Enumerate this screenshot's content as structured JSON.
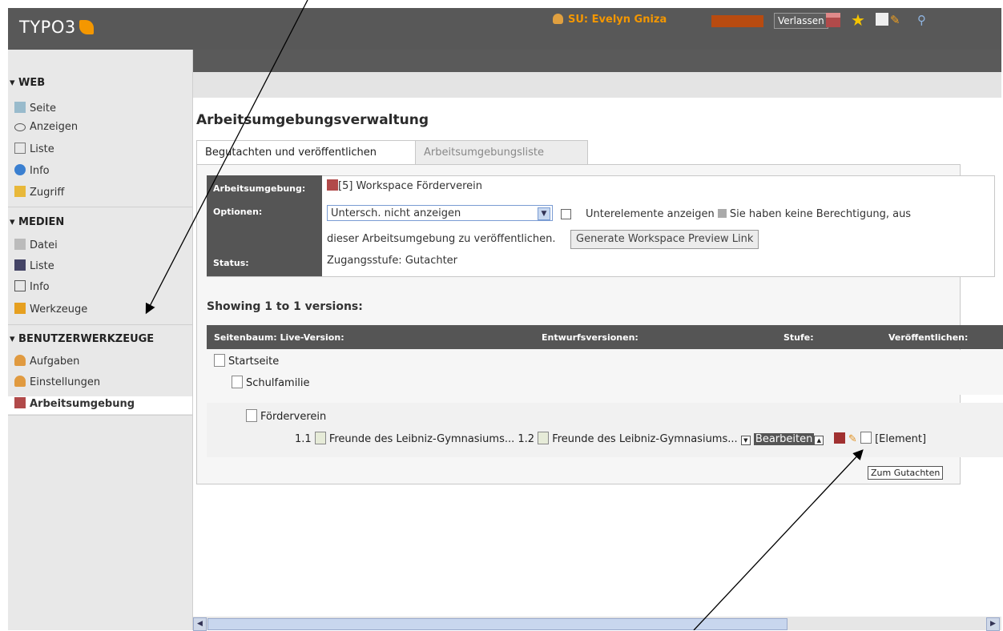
{
  "app": {
    "logo": "TYPO3"
  },
  "topbar": {
    "user_label": "SU: Evelyn Gniza",
    "leave_button": "Verlassen",
    "icons": [
      "workspace-icon",
      "star-icon",
      "clipboard-icon",
      "edit-icon",
      "search-icon"
    ]
  },
  "sidebar": {
    "sections": [
      {
        "title": "▾ WEB",
        "items": [
          "Seite",
          "Anzeigen",
          "Liste",
          "Info",
          "Zugriff"
        ]
      },
      {
        "title": "▾ MEDIEN",
        "items": [
          "Datei",
          "Liste",
          "Info",
          "Werkzeuge"
        ]
      },
      {
        "title": "▾ BENUTZERWERKZEUGE",
        "items": [
          "Aufgaben",
          "Einstellungen",
          "Arbeitsumgebung"
        ]
      }
    ],
    "active_item": "Arbeitsumgebung"
  },
  "main": {
    "title": "Arbeitsumgebungsverwaltung",
    "tabs": [
      {
        "label": "Begutachten und veröffentlichen",
        "active": true
      },
      {
        "label": "Arbeitsumgebungsliste",
        "active": false
      }
    ],
    "info": {
      "workspace_label": "Arbeitsumgebung:",
      "workspace_value": "[5] Workspace Förderverein",
      "options_label": "Optionen:",
      "select_value": "Untersch. nicht anzeigen",
      "checkbox_label": "Unterelemente anzeigen",
      "no_permission_1": "Sie haben keine Berechtigung, aus",
      "no_permission_2": "dieser Arbeitsumgebung zu veröffentlichen.",
      "preview_button": "Generate Workspace Preview Link",
      "status_label": "Status:",
      "status_value": "Zugangsstufe: Gutachter"
    },
    "showing": "Showing 1 to 1 versions:",
    "table": {
      "headers": [
        "Seitenbaum: Live-Version:",
        "Entwurfsversionen:",
        "Stufe:",
        "Veröffentlichen:"
      ],
      "tree": [
        "Startseite",
        "Schulfamilie",
        "Förderverein"
      ],
      "row": {
        "live_num": "1.1",
        "live_title": "Freunde des Leibniz-Gymnasiums...",
        "draft_num": "1.2",
        "draft_title": "Freunde des Leibniz-Gymnasiums...",
        "stage": "Bearbeiten",
        "element": "[Element]"
      }
    },
    "tooltip": "Zum Gutachten"
  },
  "colors": {
    "accent": "#f49700",
    "header": "#585858",
    "sidebar": "#e8e8e8"
  }
}
